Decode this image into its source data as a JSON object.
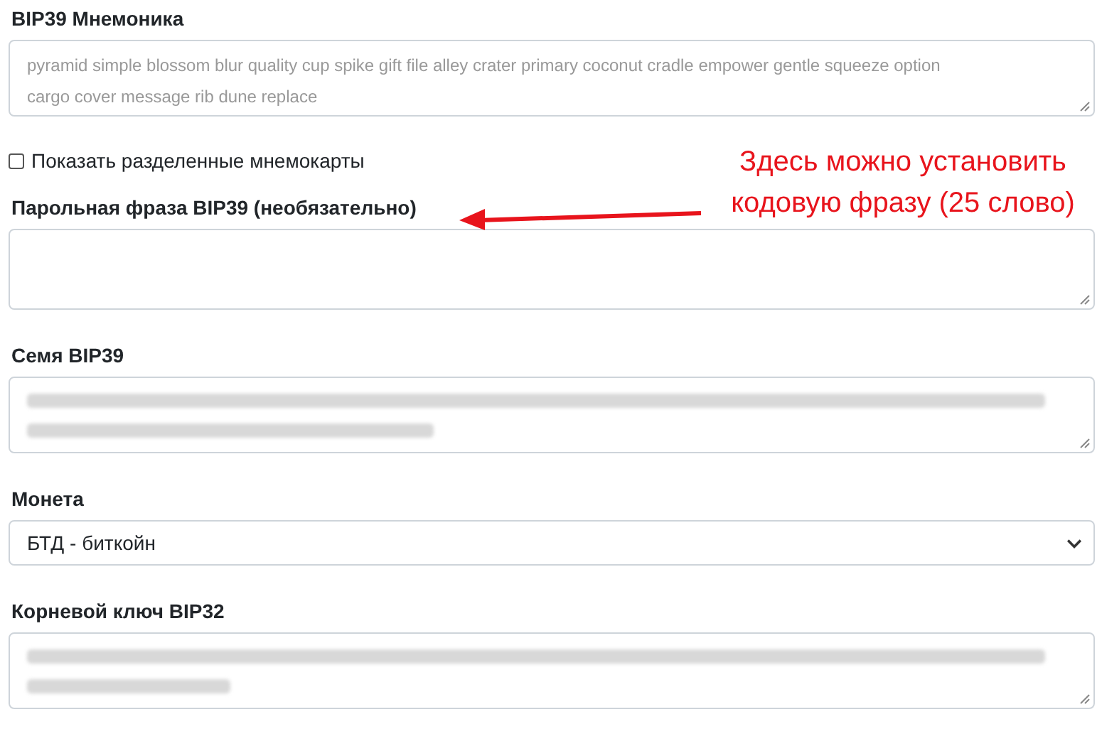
{
  "mnemonic": {
    "label": "BIP39 Мнемоника",
    "value": "pyramid simple blossom blur quality cup spike gift file alley crater primary coconut cradle empower gentle squeeze option cargo cover message rib dune replace"
  },
  "split_cards": {
    "label": "Показать разделенные мнемокарты",
    "checked": false
  },
  "passphrase": {
    "label": "Парольная фраза BIP39 (необязательно)"
  },
  "seed": {
    "label": "Семя BIP39"
  },
  "coin": {
    "label": "Монета",
    "value": "БТД - биткойн"
  },
  "root_key": {
    "label": "Корневой ключ BIP32"
  },
  "annotation": {
    "text": "Здесь можно установить кодовую фразу (25 слово)"
  }
}
